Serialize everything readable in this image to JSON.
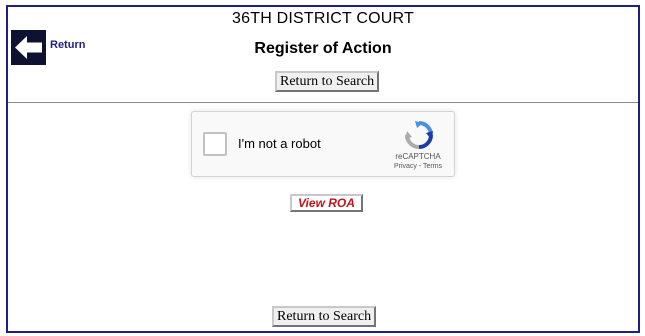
{
  "header": {
    "court_name": "36TH DISTRICT COURT",
    "page_title": "Register of Action",
    "back_label": "Return"
  },
  "buttons": {
    "return_to_search_top": "Return to Search",
    "return_to_search_bottom": "Return to Search",
    "view_roa": "View ROA"
  },
  "captcha": {
    "checkbox_label": "I'm not a robot",
    "brand": "reCAPTCHA",
    "privacy": "Privacy",
    "separator": " - ",
    "terms": "Terms",
    "checked": false
  },
  "colors": {
    "frame_border": "#1f1f8a",
    "back_icon_bg": "#0d1231",
    "view_roa_text": "#c0141b"
  },
  "icons": {
    "back": "left-arrow-icon",
    "captcha": "recaptcha-logo-icon"
  }
}
